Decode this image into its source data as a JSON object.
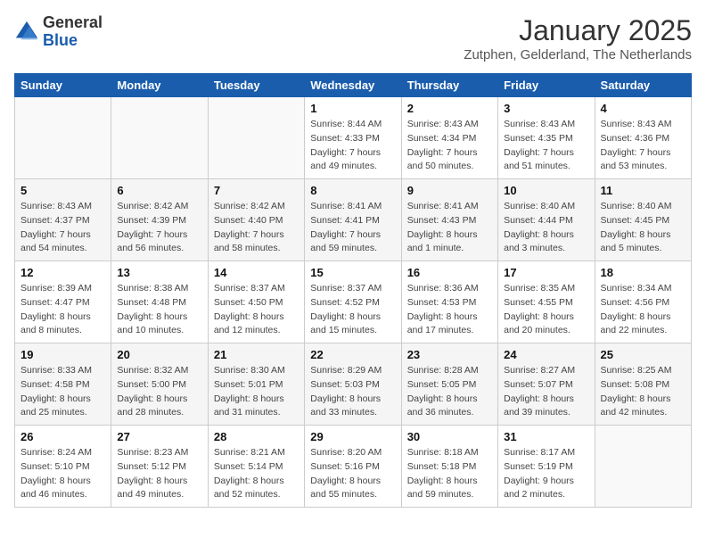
{
  "header": {
    "logo_general": "General",
    "logo_blue": "Blue",
    "title": "January 2025",
    "subtitle": "Zutphen, Gelderland, The Netherlands"
  },
  "days_of_week": [
    "Sunday",
    "Monday",
    "Tuesday",
    "Wednesday",
    "Thursday",
    "Friday",
    "Saturday"
  ],
  "weeks": [
    [
      {
        "day": "",
        "sunrise": "",
        "sunset": "",
        "daylight": ""
      },
      {
        "day": "",
        "sunrise": "",
        "sunset": "",
        "daylight": ""
      },
      {
        "day": "",
        "sunrise": "",
        "sunset": "",
        "daylight": ""
      },
      {
        "day": "1",
        "sunrise": "Sunrise: 8:44 AM",
        "sunset": "Sunset: 4:33 PM",
        "daylight": "Daylight: 7 hours and 49 minutes."
      },
      {
        "day": "2",
        "sunrise": "Sunrise: 8:43 AM",
        "sunset": "Sunset: 4:34 PM",
        "daylight": "Daylight: 7 hours and 50 minutes."
      },
      {
        "day": "3",
        "sunrise": "Sunrise: 8:43 AM",
        "sunset": "Sunset: 4:35 PM",
        "daylight": "Daylight: 7 hours and 51 minutes."
      },
      {
        "day": "4",
        "sunrise": "Sunrise: 8:43 AM",
        "sunset": "Sunset: 4:36 PM",
        "daylight": "Daylight: 7 hours and 53 minutes."
      }
    ],
    [
      {
        "day": "5",
        "sunrise": "Sunrise: 8:43 AM",
        "sunset": "Sunset: 4:37 PM",
        "daylight": "Daylight: 7 hours and 54 minutes."
      },
      {
        "day": "6",
        "sunrise": "Sunrise: 8:42 AM",
        "sunset": "Sunset: 4:39 PM",
        "daylight": "Daylight: 7 hours and 56 minutes."
      },
      {
        "day": "7",
        "sunrise": "Sunrise: 8:42 AM",
        "sunset": "Sunset: 4:40 PM",
        "daylight": "Daylight: 7 hours and 58 minutes."
      },
      {
        "day": "8",
        "sunrise": "Sunrise: 8:41 AM",
        "sunset": "Sunset: 4:41 PM",
        "daylight": "Daylight: 7 hours and 59 minutes."
      },
      {
        "day": "9",
        "sunrise": "Sunrise: 8:41 AM",
        "sunset": "Sunset: 4:43 PM",
        "daylight": "Daylight: 8 hours and 1 minute."
      },
      {
        "day": "10",
        "sunrise": "Sunrise: 8:40 AM",
        "sunset": "Sunset: 4:44 PM",
        "daylight": "Daylight: 8 hours and 3 minutes."
      },
      {
        "day": "11",
        "sunrise": "Sunrise: 8:40 AM",
        "sunset": "Sunset: 4:45 PM",
        "daylight": "Daylight: 8 hours and 5 minutes."
      }
    ],
    [
      {
        "day": "12",
        "sunrise": "Sunrise: 8:39 AM",
        "sunset": "Sunset: 4:47 PM",
        "daylight": "Daylight: 8 hours and 8 minutes."
      },
      {
        "day": "13",
        "sunrise": "Sunrise: 8:38 AM",
        "sunset": "Sunset: 4:48 PM",
        "daylight": "Daylight: 8 hours and 10 minutes."
      },
      {
        "day": "14",
        "sunrise": "Sunrise: 8:37 AM",
        "sunset": "Sunset: 4:50 PM",
        "daylight": "Daylight: 8 hours and 12 minutes."
      },
      {
        "day": "15",
        "sunrise": "Sunrise: 8:37 AM",
        "sunset": "Sunset: 4:52 PM",
        "daylight": "Daylight: 8 hours and 15 minutes."
      },
      {
        "day": "16",
        "sunrise": "Sunrise: 8:36 AM",
        "sunset": "Sunset: 4:53 PM",
        "daylight": "Daylight: 8 hours and 17 minutes."
      },
      {
        "day": "17",
        "sunrise": "Sunrise: 8:35 AM",
        "sunset": "Sunset: 4:55 PM",
        "daylight": "Daylight: 8 hours and 20 minutes."
      },
      {
        "day": "18",
        "sunrise": "Sunrise: 8:34 AM",
        "sunset": "Sunset: 4:56 PM",
        "daylight": "Daylight: 8 hours and 22 minutes."
      }
    ],
    [
      {
        "day": "19",
        "sunrise": "Sunrise: 8:33 AM",
        "sunset": "Sunset: 4:58 PM",
        "daylight": "Daylight: 8 hours and 25 minutes."
      },
      {
        "day": "20",
        "sunrise": "Sunrise: 8:32 AM",
        "sunset": "Sunset: 5:00 PM",
        "daylight": "Daylight: 8 hours and 28 minutes."
      },
      {
        "day": "21",
        "sunrise": "Sunrise: 8:30 AM",
        "sunset": "Sunset: 5:01 PM",
        "daylight": "Daylight: 8 hours and 31 minutes."
      },
      {
        "day": "22",
        "sunrise": "Sunrise: 8:29 AM",
        "sunset": "Sunset: 5:03 PM",
        "daylight": "Daylight: 8 hours and 33 minutes."
      },
      {
        "day": "23",
        "sunrise": "Sunrise: 8:28 AM",
        "sunset": "Sunset: 5:05 PM",
        "daylight": "Daylight: 8 hours and 36 minutes."
      },
      {
        "day": "24",
        "sunrise": "Sunrise: 8:27 AM",
        "sunset": "Sunset: 5:07 PM",
        "daylight": "Daylight: 8 hours and 39 minutes."
      },
      {
        "day": "25",
        "sunrise": "Sunrise: 8:25 AM",
        "sunset": "Sunset: 5:08 PM",
        "daylight": "Daylight: 8 hours and 42 minutes."
      }
    ],
    [
      {
        "day": "26",
        "sunrise": "Sunrise: 8:24 AM",
        "sunset": "Sunset: 5:10 PM",
        "daylight": "Daylight: 8 hours and 46 minutes."
      },
      {
        "day": "27",
        "sunrise": "Sunrise: 8:23 AM",
        "sunset": "Sunset: 5:12 PM",
        "daylight": "Daylight: 8 hours and 49 minutes."
      },
      {
        "day": "28",
        "sunrise": "Sunrise: 8:21 AM",
        "sunset": "Sunset: 5:14 PM",
        "daylight": "Daylight: 8 hours and 52 minutes."
      },
      {
        "day": "29",
        "sunrise": "Sunrise: 8:20 AM",
        "sunset": "Sunset: 5:16 PM",
        "daylight": "Daylight: 8 hours and 55 minutes."
      },
      {
        "day": "30",
        "sunrise": "Sunrise: 8:18 AM",
        "sunset": "Sunset: 5:18 PM",
        "daylight": "Daylight: 8 hours and 59 minutes."
      },
      {
        "day": "31",
        "sunrise": "Sunrise: 8:17 AM",
        "sunset": "Sunset: 5:19 PM",
        "daylight": "Daylight: 9 hours and 2 minutes."
      },
      {
        "day": "",
        "sunrise": "",
        "sunset": "",
        "daylight": ""
      }
    ]
  ]
}
